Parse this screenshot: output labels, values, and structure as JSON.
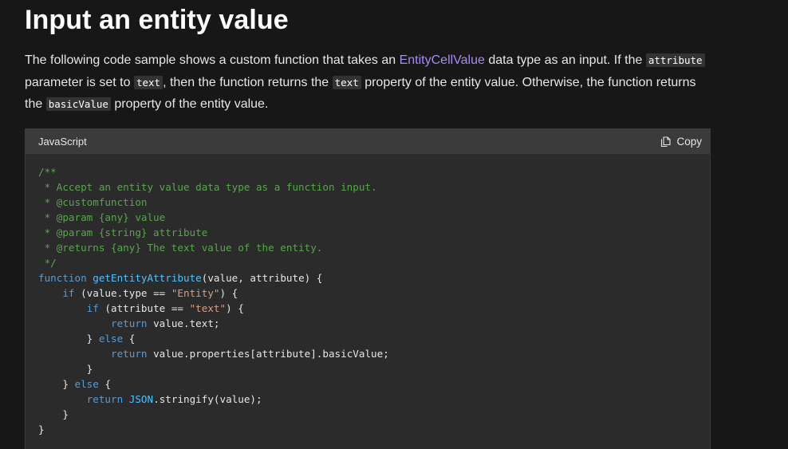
{
  "heading": "Input an entity value",
  "paragraph": {
    "part1": "The following code sample shows a custom function that takes an ",
    "link": "EntityCellValue",
    "part2": " data type as an input. If the ",
    "code1": "attribute",
    "part3": " parameter is set to ",
    "code2": "text",
    "part4": ", then the function returns the ",
    "code3": "text",
    "part5": " property of the entity value. Otherwise, the function returns the ",
    "code4": "basicValue",
    "part6": " property of the entity value."
  },
  "code_block": {
    "language": "JavaScript",
    "copy_label": "Copy",
    "copy_icon": "copy-icon",
    "lines": {
      "l1": "/**",
      "l2": " * Accept an entity value data type as a function input.",
      "l3": " * @customfunction",
      "l4": " * @param {any} value",
      "l5": " * @param {string} attribute",
      "l6": " * @returns {any} The text value of the entity.",
      "l7": " */",
      "l8_kw": "function",
      "l8_fn": "getEntityAttribute",
      "l8_rest": "(value, attribute) {",
      "l9_kw": "if",
      "l9_a": " (value.type == ",
      "l9_str": "\"Entity\"",
      "l9_b": ") {",
      "l10_kw": "if",
      "l10_a": " (attribute == ",
      "l10_str": "\"text\"",
      "l10_b": ") {",
      "l11_kw": "return",
      "l11_rest": " value.text;",
      "l12_a": "} ",
      "l12_kw": "else",
      "l12_b": " {",
      "l13_kw": "return",
      "l13_rest": " value.properties[attribute].basicValue;",
      "l14": "}",
      "l15_a": "} ",
      "l15_kw": "else",
      "l15_b": " {",
      "l16_kw": "return",
      "l16_obj": "JSON",
      "l16_rest": ".stringify(value);",
      "l17": "}",
      "l18": "}"
    }
  },
  "colors": {
    "background": "#171717",
    "code_background": "#2b2b2b",
    "link": "#a68cf0",
    "comment": "#57a64a",
    "keyword": "#569cd6",
    "function_name": "#4fc1ff",
    "string": "#d69d85"
  }
}
